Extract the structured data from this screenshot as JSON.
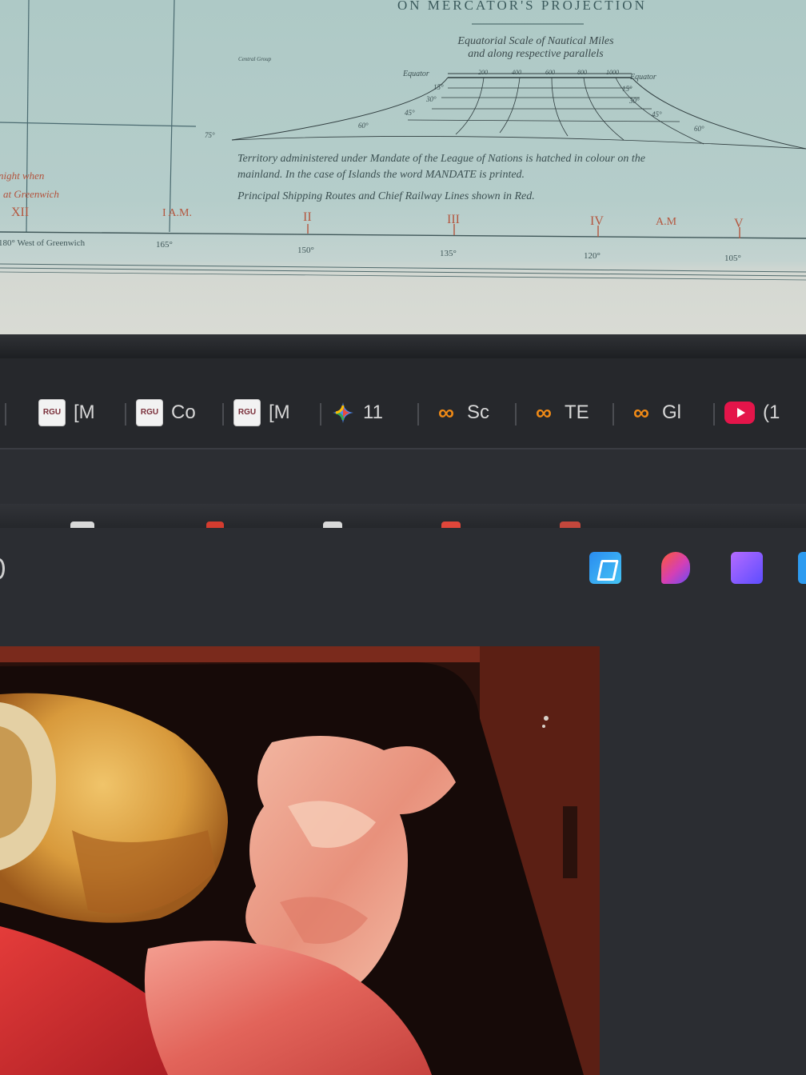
{
  "map": {
    "title": "ON MERCATOR'S PROJECTION",
    "scale_title_line1": "Equatorial Scale of Nautical Miles",
    "scale_title_line2": "and along respective parallels",
    "scale_labels": {
      "equator_left": "Equator",
      "equator_right": "Equator",
      "lat_15": "15°",
      "lat_30": "30°",
      "lat_45": "45°",
      "lat_60": "60°",
      "lat_75": "75°",
      "ticks": [
        "200",
        "400",
        "600",
        "800",
        "1000"
      ]
    },
    "small_label": "Central Group",
    "note_line1": "Territory administered under Mandate of the League of Nations is hatched in colour on the",
    "note_line2": "mainland. In the case of Islands the word MANDATE is printed.",
    "note_line3": "Principal Shipping Routes and Chief Railway Lines shown in Red.",
    "left_note_line1": "night when",
    "left_note_line2": "at Greenwich",
    "time_marks": [
      "XII",
      "I A.M.",
      "II",
      "III",
      "IV",
      "A.M",
      "V"
    ],
    "longitudes": [
      "180° West of Greenwich",
      "165°",
      "150°",
      "135°",
      "120°",
      "105°"
    ]
  },
  "tabs": [
    {
      "icon": "rgu-icon",
      "label": "[M"
    },
    {
      "icon": "rgu-icon",
      "label": "Co"
    },
    {
      "icon": "rgu-icon",
      "label": "[M"
    },
    {
      "icon": "gemini-icon",
      "label": "11"
    },
    {
      "icon": "copilot-loop-icon",
      "label": "Sc"
    },
    {
      "icon": "copilot-loop-icon",
      "label": "TE"
    },
    {
      "icon": "copilot-loop-icon",
      "label": "Gl"
    },
    {
      "icon": "youtube-icon",
      "label": "(1"
    }
  ],
  "rgu_icon_text": "RGU",
  "extensions": [
    "copilot-icon",
    "designer-icon",
    "clipchamp-icon",
    "edge-extension-icon"
  ],
  "colors": {
    "map_bg": "#b5cdca",
    "tabbar_bg": "#26282c",
    "page_bg": "#2b2d32",
    "accent_orange": "#f08a16",
    "youtube_red": "#e4154a"
  }
}
